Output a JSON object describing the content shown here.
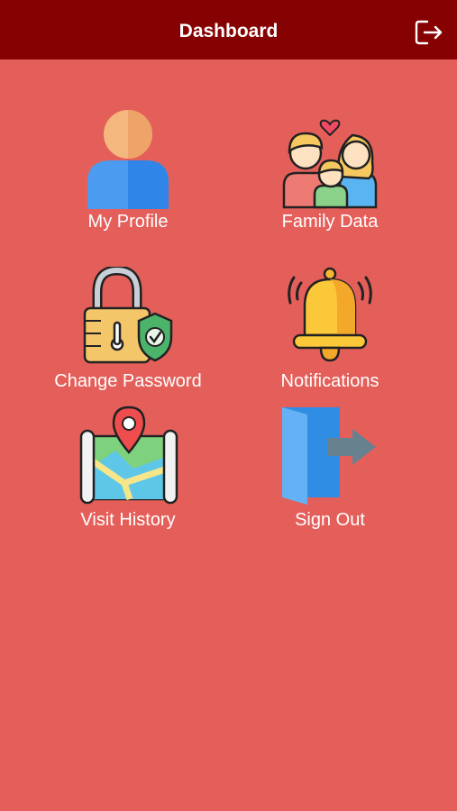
{
  "header": {
    "title": "Dashboard",
    "logout_icon": "logout-icon"
  },
  "tiles": [
    {
      "label": "My Profile",
      "icon": "user-profile-icon"
    },
    {
      "label": "Family Data",
      "icon": "family-icon"
    },
    {
      "label": "Change Password",
      "icon": "padlock-shield-icon"
    },
    {
      "label": "Notifications",
      "icon": "bell-icon"
    },
    {
      "label": "Visit History",
      "icon": "map-pin-icon"
    },
    {
      "label": "Sign Out",
      "icon": "door-exit-icon"
    }
  ],
  "colors": {
    "header_bg": "#860101",
    "page_bg": "#e45f5a",
    "text": "#ffffff"
  }
}
